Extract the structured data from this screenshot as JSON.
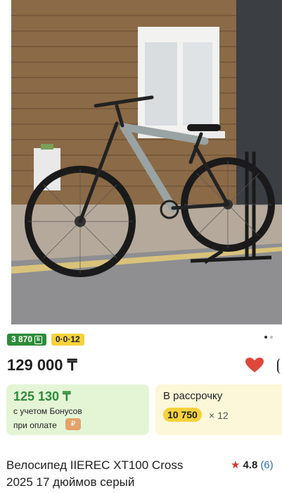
{
  "product": {
    "image_alt": "bicycle-photo",
    "bonus_badge": "3 870",
    "bonus_badge_icon": "Б",
    "installment_badge": "0·0·12",
    "carousel_count": 2,
    "carousel_active": 0,
    "price": "129 000 ₸",
    "title_line1": "Велосипед IIEREC XT100 Cross",
    "title_line2": "2025 17 дюймов серый",
    "rating": "4.8",
    "reviews": "(6)"
  },
  "bonus_card": {
    "price": "125 130 ₸",
    "note1": "с учетом Бонусов",
    "note2": "при оплате",
    "pay_icon_glyph": "₽"
  },
  "installment_card": {
    "title": "В рассрочку",
    "amount": "10 750",
    "multiplier": "× 12"
  },
  "colors": {
    "green": "#2e8b3a",
    "yellow": "#f5d23a",
    "heart": "#e0473c"
  }
}
